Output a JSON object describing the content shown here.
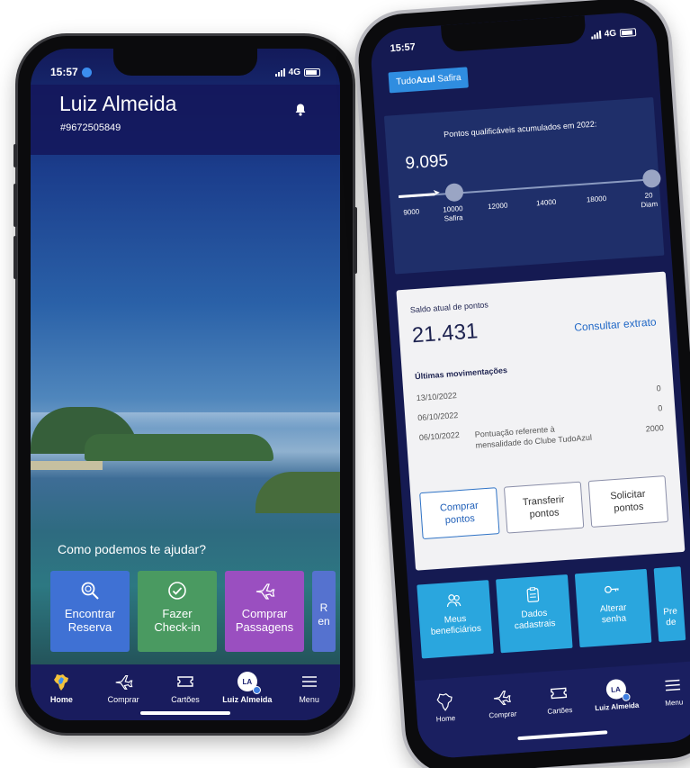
{
  "left_phone": {
    "status": {
      "time": "15:57",
      "network": "4G"
    },
    "header": {
      "user_name": "Luiz Almeida",
      "user_id": "#9672505849"
    },
    "help_prompt": "Como podemos te ajudar?",
    "tiles": [
      {
        "line1": "Encontrar",
        "line2": "Reserva",
        "icon": "search-icon"
      },
      {
        "line1": "Fazer",
        "line2": "Check-in",
        "icon": "check-circle-icon"
      },
      {
        "line1": "Comprar",
        "line2": "Passagens",
        "icon": "plane-icon"
      },
      {
        "line1": "R",
        "line2": "en",
        "icon": ""
      }
    ],
    "tabbar": [
      {
        "label": "Home",
        "icon": "brazil-map-icon",
        "active": true
      },
      {
        "label": "Comprar",
        "icon": "plane-icon",
        "active": false
      },
      {
        "label": "Cartões",
        "icon": "ticket-icon",
        "active": false
      },
      {
        "label": "Luiz Almeida",
        "icon": "avatar",
        "active": false
      },
      {
        "label": "Menu",
        "icon": "hamburger-icon",
        "active": false
      }
    ],
    "avatar_initials": "LA"
  },
  "right_phone": {
    "status": {
      "time": "15:57",
      "network": "4G"
    },
    "tier_chip": {
      "prefix": "Tudo",
      "bold": "Azul",
      "suffix": " Safira"
    },
    "points_panel": {
      "title": "Pontos qualificáveis acumulados em 2022:",
      "value": "9.095",
      "ticks": [
        {
          "label": "9000",
          "sub": ""
        },
        {
          "label": "10000",
          "sub": "Safira"
        },
        {
          "label": "12000",
          "sub": ""
        },
        {
          "label": "14000",
          "sub": ""
        },
        {
          "label": "18000",
          "sub": ""
        },
        {
          "label": "20",
          "sub": "Diam"
        }
      ]
    },
    "balance_card": {
      "label": "Saldo atual de pontos",
      "balance": "21.431",
      "link": "Consultar extrato",
      "section_title": "Últimas movimentações",
      "rows": [
        {
          "date": "13/10/2022",
          "desc": "",
          "points": "0"
        },
        {
          "date": "06/10/2022",
          "desc": "",
          "points": "0"
        },
        {
          "date": "06/10/2022",
          "desc": "Pontuação referente à mensalidade do Clube TudoAzul",
          "points": "2000"
        }
      ],
      "buttons": [
        {
          "line1": "Comprar",
          "line2": "pontos"
        },
        {
          "line1": "Transferir",
          "line2": "pontos"
        },
        {
          "line1": "Solicitar",
          "line2": "pontos"
        }
      ]
    },
    "tiles": [
      {
        "line1": "Meus",
        "line2": "beneficiários",
        "icon": "people-icon"
      },
      {
        "line1": "Dados",
        "line2": "cadastrais",
        "icon": "clipboard-icon"
      },
      {
        "line1": "Alterar",
        "line2": "senha",
        "icon": "key-icon"
      },
      {
        "line1": "Pre",
        "line2": "de",
        "icon": ""
      }
    ],
    "tabbar": [
      {
        "label": "Home",
        "icon": "brazil-map-icon"
      },
      {
        "label": "Comprar",
        "icon": "plane-icon"
      },
      {
        "label": "Cartões",
        "icon": "ticket-icon"
      },
      {
        "label": "Luiz Almeida",
        "icon": "avatar"
      },
      {
        "label": "Menu",
        "icon": "hamburger-icon"
      }
    ],
    "avatar_initials": "LA"
  }
}
